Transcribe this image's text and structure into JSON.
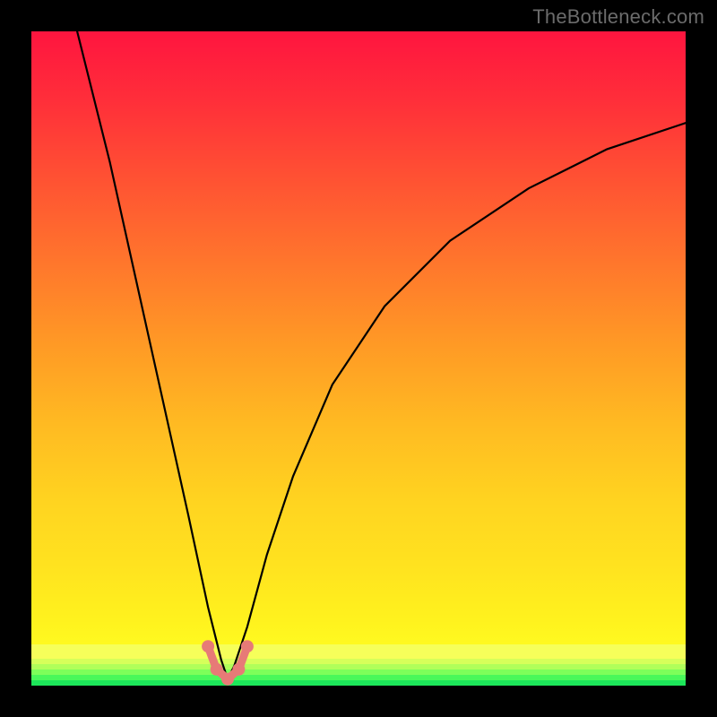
{
  "watermark": "TheBottleneck.com",
  "chart_data": {
    "type": "line",
    "title": "",
    "xlabel": "",
    "ylabel": "",
    "xlim": [
      0,
      100
    ],
    "ylim": [
      0,
      100
    ],
    "background_gradient": {
      "top": "#ff153f",
      "mid": "#ffd420",
      "bottom_band": "#f6ff5a",
      "bottom_green": "#1de65a"
    },
    "series": [
      {
        "name": "bottleneck-curve",
        "note": "V-shaped curve; y≈0 at the notch near x≈30, rises toward 100 at the edges. Values are read/estimated from the plot area as percentages of each axis.",
        "x": [
          7,
          12,
          16,
          20,
          24,
          27,
          29,
          30,
          31,
          33,
          36,
          40,
          46,
          54,
          64,
          76,
          88,
          100
        ],
        "y": [
          100,
          80,
          62,
          44,
          26,
          12,
          4,
          1,
          3,
          9,
          20,
          32,
          46,
          58,
          68,
          76,
          82,
          86
        ]
      }
    ],
    "markers": {
      "name": "notch-dots",
      "note": "small salmon dots + connector at the valley; values are (x%, y%) in plot coords",
      "points": [
        {
          "x": 27.0,
          "y": 6.0
        },
        {
          "x": 28.3,
          "y": 2.5
        },
        {
          "x": 30.0,
          "y": 1.0
        },
        {
          "x": 31.7,
          "y": 2.5
        },
        {
          "x": 33.0,
          "y": 6.0
        }
      ],
      "color": "#e77a77"
    }
  }
}
